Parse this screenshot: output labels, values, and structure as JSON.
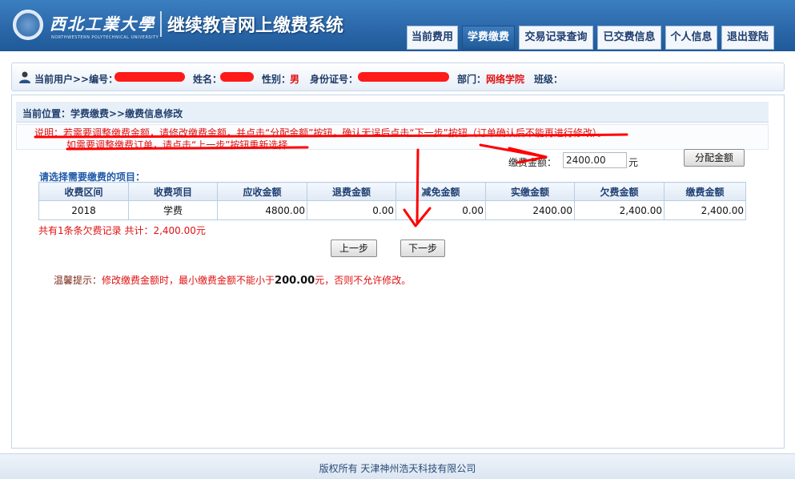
{
  "header": {
    "logo_name": "西北工業大學",
    "logo_en": "NORTHWESTERN POLYTECHNICAL UNIVERSITY",
    "system_title": "继续教育网上缴费系统",
    "nav": [
      "当前费用",
      "学费缴费",
      "交易记录查询",
      "已交费信息",
      "个人信息",
      "退出登陆"
    ],
    "active_nav": "学费缴费"
  },
  "user": {
    "current_user_label": "当前用户>>编号：",
    "name_label": "姓名：",
    "gender_label": "性别：",
    "gender_value": "男",
    "id_label": "身份证号：",
    "dept_label": "部门：",
    "dept_value": "网络学院",
    "class_label": "班级："
  },
  "breadcrumb": "当前位置：学费缴费>>缴费信息修改",
  "notes": {
    "line1": "说明：若需要调整缴费金额，请修改缴费金额，并点击“分配金额”按钮，确认无误后点击“下一步”按钮（订单确认后不能再进行修改）。",
    "line2": "如需要调整缴费订单，请点击“上一步”按钮重新选择"
  },
  "amount": {
    "label": "缴费金额：",
    "value": "2400.00",
    "unit": "元",
    "allocate_button": "分配金额"
  },
  "select_label": "请选择需要缴费的项目：",
  "table": {
    "headers": [
      "收费区间",
      "收费项目",
      "应收金额",
      "退费金额",
      "减免金额",
      "实缴金额",
      "欠费金额",
      "缴费金额"
    ],
    "rows": [
      [
        "2018",
        "学费",
        "4800.00",
        "0.00",
        "0.00",
        "2400.00",
        "2,400.00",
        "2,400.00"
      ]
    ]
  },
  "summary": "共有1条条欠费记录  共计：2,400.00元",
  "buttons": {
    "prev": "上一步",
    "next": "下一步"
  },
  "tip": {
    "label": "温馨提示：",
    "text_before": "修改缴费金额时，最小缴费金额不能小于",
    "min_amount": "200.00",
    "text_after": "元，否则不允许修改。"
  },
  "footer": "版权所有 天津神州浩天科技有限公司",
  "colors": {
    "header_blue": "#2e6cae",
    "alert_red": "#e01010",
    "annotation_red": "#ff0000"
  }
}
